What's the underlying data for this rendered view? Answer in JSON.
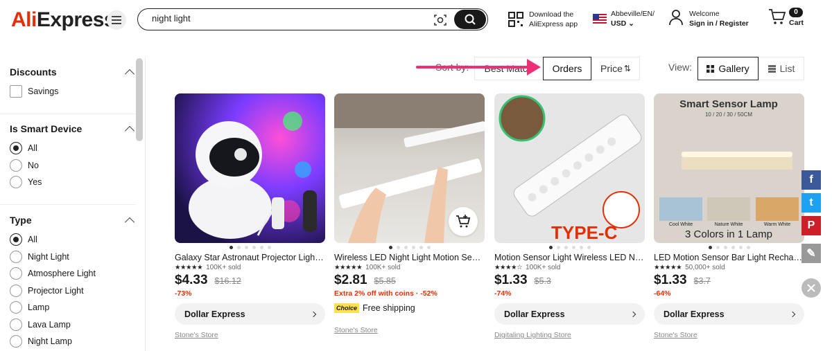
{
  "header": {
    "logo_prefix": "Ali",
    "logo_suffix": "Express",
    "search_value": "night light",
    "app_line1": "Download the",
    "app_line2": "AliExpress app",
    "region_line1": "Abbeville/EN/",
    "region_line2": "USD",
    "account_line1": "Welcome",
    "account_line2": "Sign in / Register",
    "cart_count": "0",
    "cart_label": "Cart"
  },
  "sidebar": {
    "discounts": {
      "title": "Discounts",
      "options": [
        "Savings"
      ]
    },
    "smart": {
      "title": "Is Smart Device",
      "options": [
        "All",
        "No",
        "Yes"
      ],
      "selected": "All"
    },
    "type": {
      "title": "Type",
      "options": [
        "All",
        "Night Light",
        "Atmosphere Light",
        "Projector Light",
        "Lamp",
        "Lava Lamp",
        "Night Lamp"
      ],
      "selected": "All"
    }
  },
  "sort": {
    "label": "Sort by:",
    "options": [
      "Best Match",
      "Orders",
      "Price"
    ],
    "active": "Orders"
  },
  "view": {
    "label": "View:",
    "options": [
      "Gallery",
      "List"
    ],
    "active": "Gallery"
  },
  "products": [
    {
      "title": "Galaxy Star Astronaut Projector Light Night Light",
      "sold": "100K+ sold",
      "price": "$4.33",
      "old_price": "$16.12",
      "discount": "-73%",
      "store_btn": "Dollar Express",
      "store": "Stone's Store",
      "image_label": "",
      "image_sub": ""
    },
    {
      "title": "Wireless LED Night Light Motion Sensor",
      "sold": "100K+ sold",
      "price": "$2.81",
      "old_price": "$5.85",
      "discount": "Extra 2% off with coins · -52%",
      "choice_badge": "Choice",
      "shipping": "Free shipping",
      "store": "Stone's Store",
      "image_label": "",
      "image_sub": ""
    },
    {
      "title": "Motion Sensor Light Wireless LED Night Light",
      "sold": "100K+ sold",
      "price": "$1.33",
      "old_price": "$5.3",
      "discount": "-74%",
      "store_btn": "Dollar Express",
      "store": "Digitaling Lighting Store",
      "image_label": "TYPE-C",
      "image_sub": ""
    },
    {
      "title": "LED Motion Sensor Bar Light Rechargeable",
      "sold": "50,000+ sold",
      "price": "$1.33",
      "old_price": "$3.7",
      "discount": "-64%",
      "store_btn": "Dollar Express",
      "store": "Stone's Store",
      "image_label": "Smart Sensor Lamp",
      "image_sub": "10 / 20 / 30 / 50CM",
      "image_bottom": "3 Colors in 1 Lamp",
      "swatches": [
        "Cool White",
        "Nature White",
        "Warm White"
      ]
    }
  ],
  "social": [
    "f",
    "t",
    "P",
    "✎"
  ],
  "colors": {
    "brand": "#e62e04",
    "annotation_arrow": "#ee2f78",
    "facebook": "#3b5998",
    "twitter": "#1da1f2",
    "pinterest": "#cb2027",
    "edit": "#999999"
  }
}
